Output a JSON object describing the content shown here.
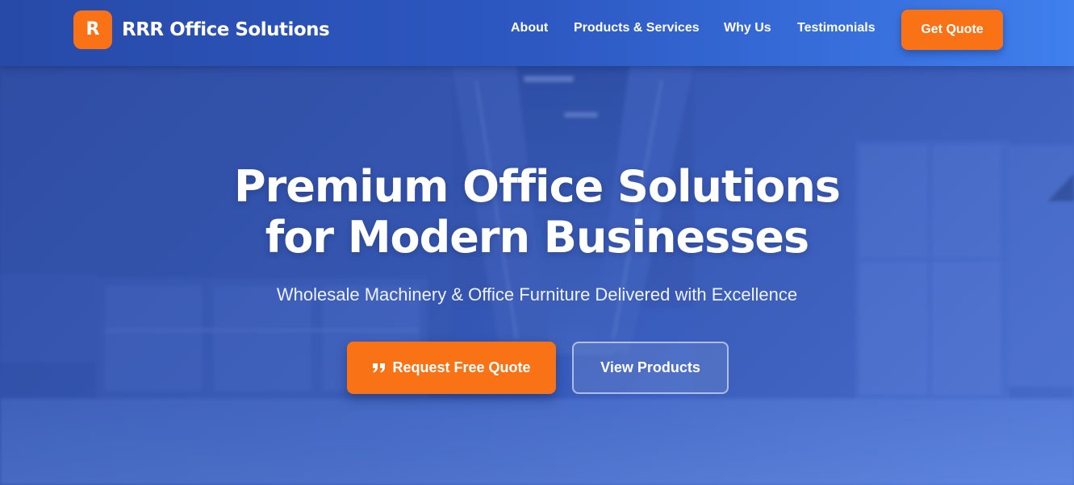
{
  "brand": {
    "badge_letter": "R",
    "name": "RRR Office Solutions",
    "badge_color": "#f97316"
  },
  "nav": {
    "links": [
      "About",
      "Products & Services",
      "Why Us",
      "Testimonials"
    ],
    "cta_label": "Get Quote"
  },
  "hero": {
    "headline_line1": "Premium Office Solutions",
    "headline_line2": "for Modern Businesses",
    "subheadline": "Wholesale Machinery & Office Furniture Delivered with Excellence",
    "primary_button": {
      "icon": "quote-icon",
      "label": "Request Free Quote"
    },
    "secondary_button": {
      "label": "View Products"
    },
    "background": "blurred-office-hallway-photo"
  },
  "colors": {
    "accent": "#f97316",
    "nav_start": "#274aa8",
    "nav_end": "#3f7fee",
    "hero_blue": "#3558b6"
  }
}
